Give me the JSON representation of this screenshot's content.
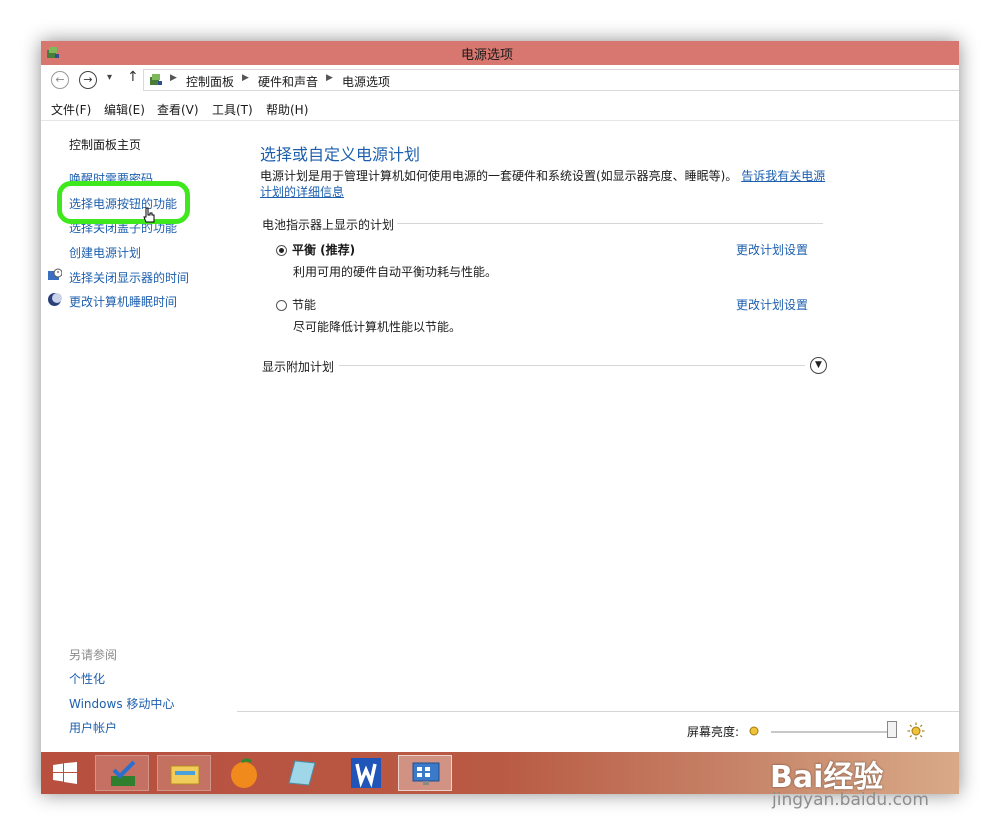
{
  "window": {
    "title": "电源选项"
  },
  "address": {
    "back": "←",
    "forward": "→",
    "dropdown": "▾",
    "up": "↑",
    "breadcrumbs": [
      "控制面板",
      "硬件和声音",
      "电源选项"
    ]
  },
  "menu": [
    "文件(F)",
    "编辑(E)",
    "查看(V)",
    "工具(T)",
    "帮助(H)"
  ],
  "sidebar": {
    "home": "控制面板主页",
    "items": [
      "唤醒时需要密码",
      "选择电源按钮的功能",
      "选择关闭盖子的功能",
      "创建电源计划",
      "选择关闭显示器的时间",
      "更改计算机睡眠时间"
    ],
    "see_also_heading": "另请参阅",
    "see_also": [
      "个性化",
      "Windows 移动中心",
      "用户帐户"
    ]
  },
  "main": {
    "title": "选择或自定义电源计划",
    "description": "电源计划是用于管理计算机如何使用电源的一套硬件和系统设置(如显示器亮度、睡眠等)。",
    "description_link": "告诉我有关电源计划的详细信息",
    "battery_group": "电池指示器上显示的计划",
    "plans": [
      {
        "name": "平衡 (推荐)",
        "desc": "利用可用的硬件自动平衡功耗与性能。",
        "link": "更改计划设置",
        "selected": true
      },
      {
        "name": "节能",
        "desc": "尽可能降低计算机性能以节能。",
        "link": "更改计划设置",
        "selected": false
      }
    ],
    "additional": "显示附加计划",
    "brightness_label": "屏幕亮度:"
  },
  "watermark": {
    "main": "Bai经验",
    "sub": "jingyan.baidu.com"
  },
  "colors": {
    "titlebar": "#d7776f",
    "link": "#1d5fae",
    "highlight": "#3fe81c",
    "taskbar": "#b84f3f"
  }
}
